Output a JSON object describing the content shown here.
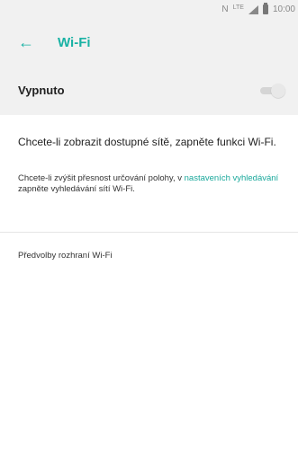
{
  "status_bar": {
    "nfc": "N",
    "network": "LTE",
    "time": "10:00"
  },
  "header": {
    "back_icon": "arrow-left-icon",
    "title": "Wi-Fi",
    "accent": "#19b2a4"
  },
  "toggle": {
    "label": "Vypnuto",
    "state": "off"
  },
  "content": {
    "message_main": "Chcete-li zobrazit dostupné sítě, zapněte funkci Wi-Fi.",
    "message_detail_prefix": "Chcete-li zvýšit přesnost určování polohy, v ",
    "message_detail_link": "nastaveních vyhledávání",
    "message_detail_suffix": " zapněte vyhledávání sítí Wi-Fi.",
    "preferences_label": "Předvolby rozhraní Wi-Fi"
  }
}
